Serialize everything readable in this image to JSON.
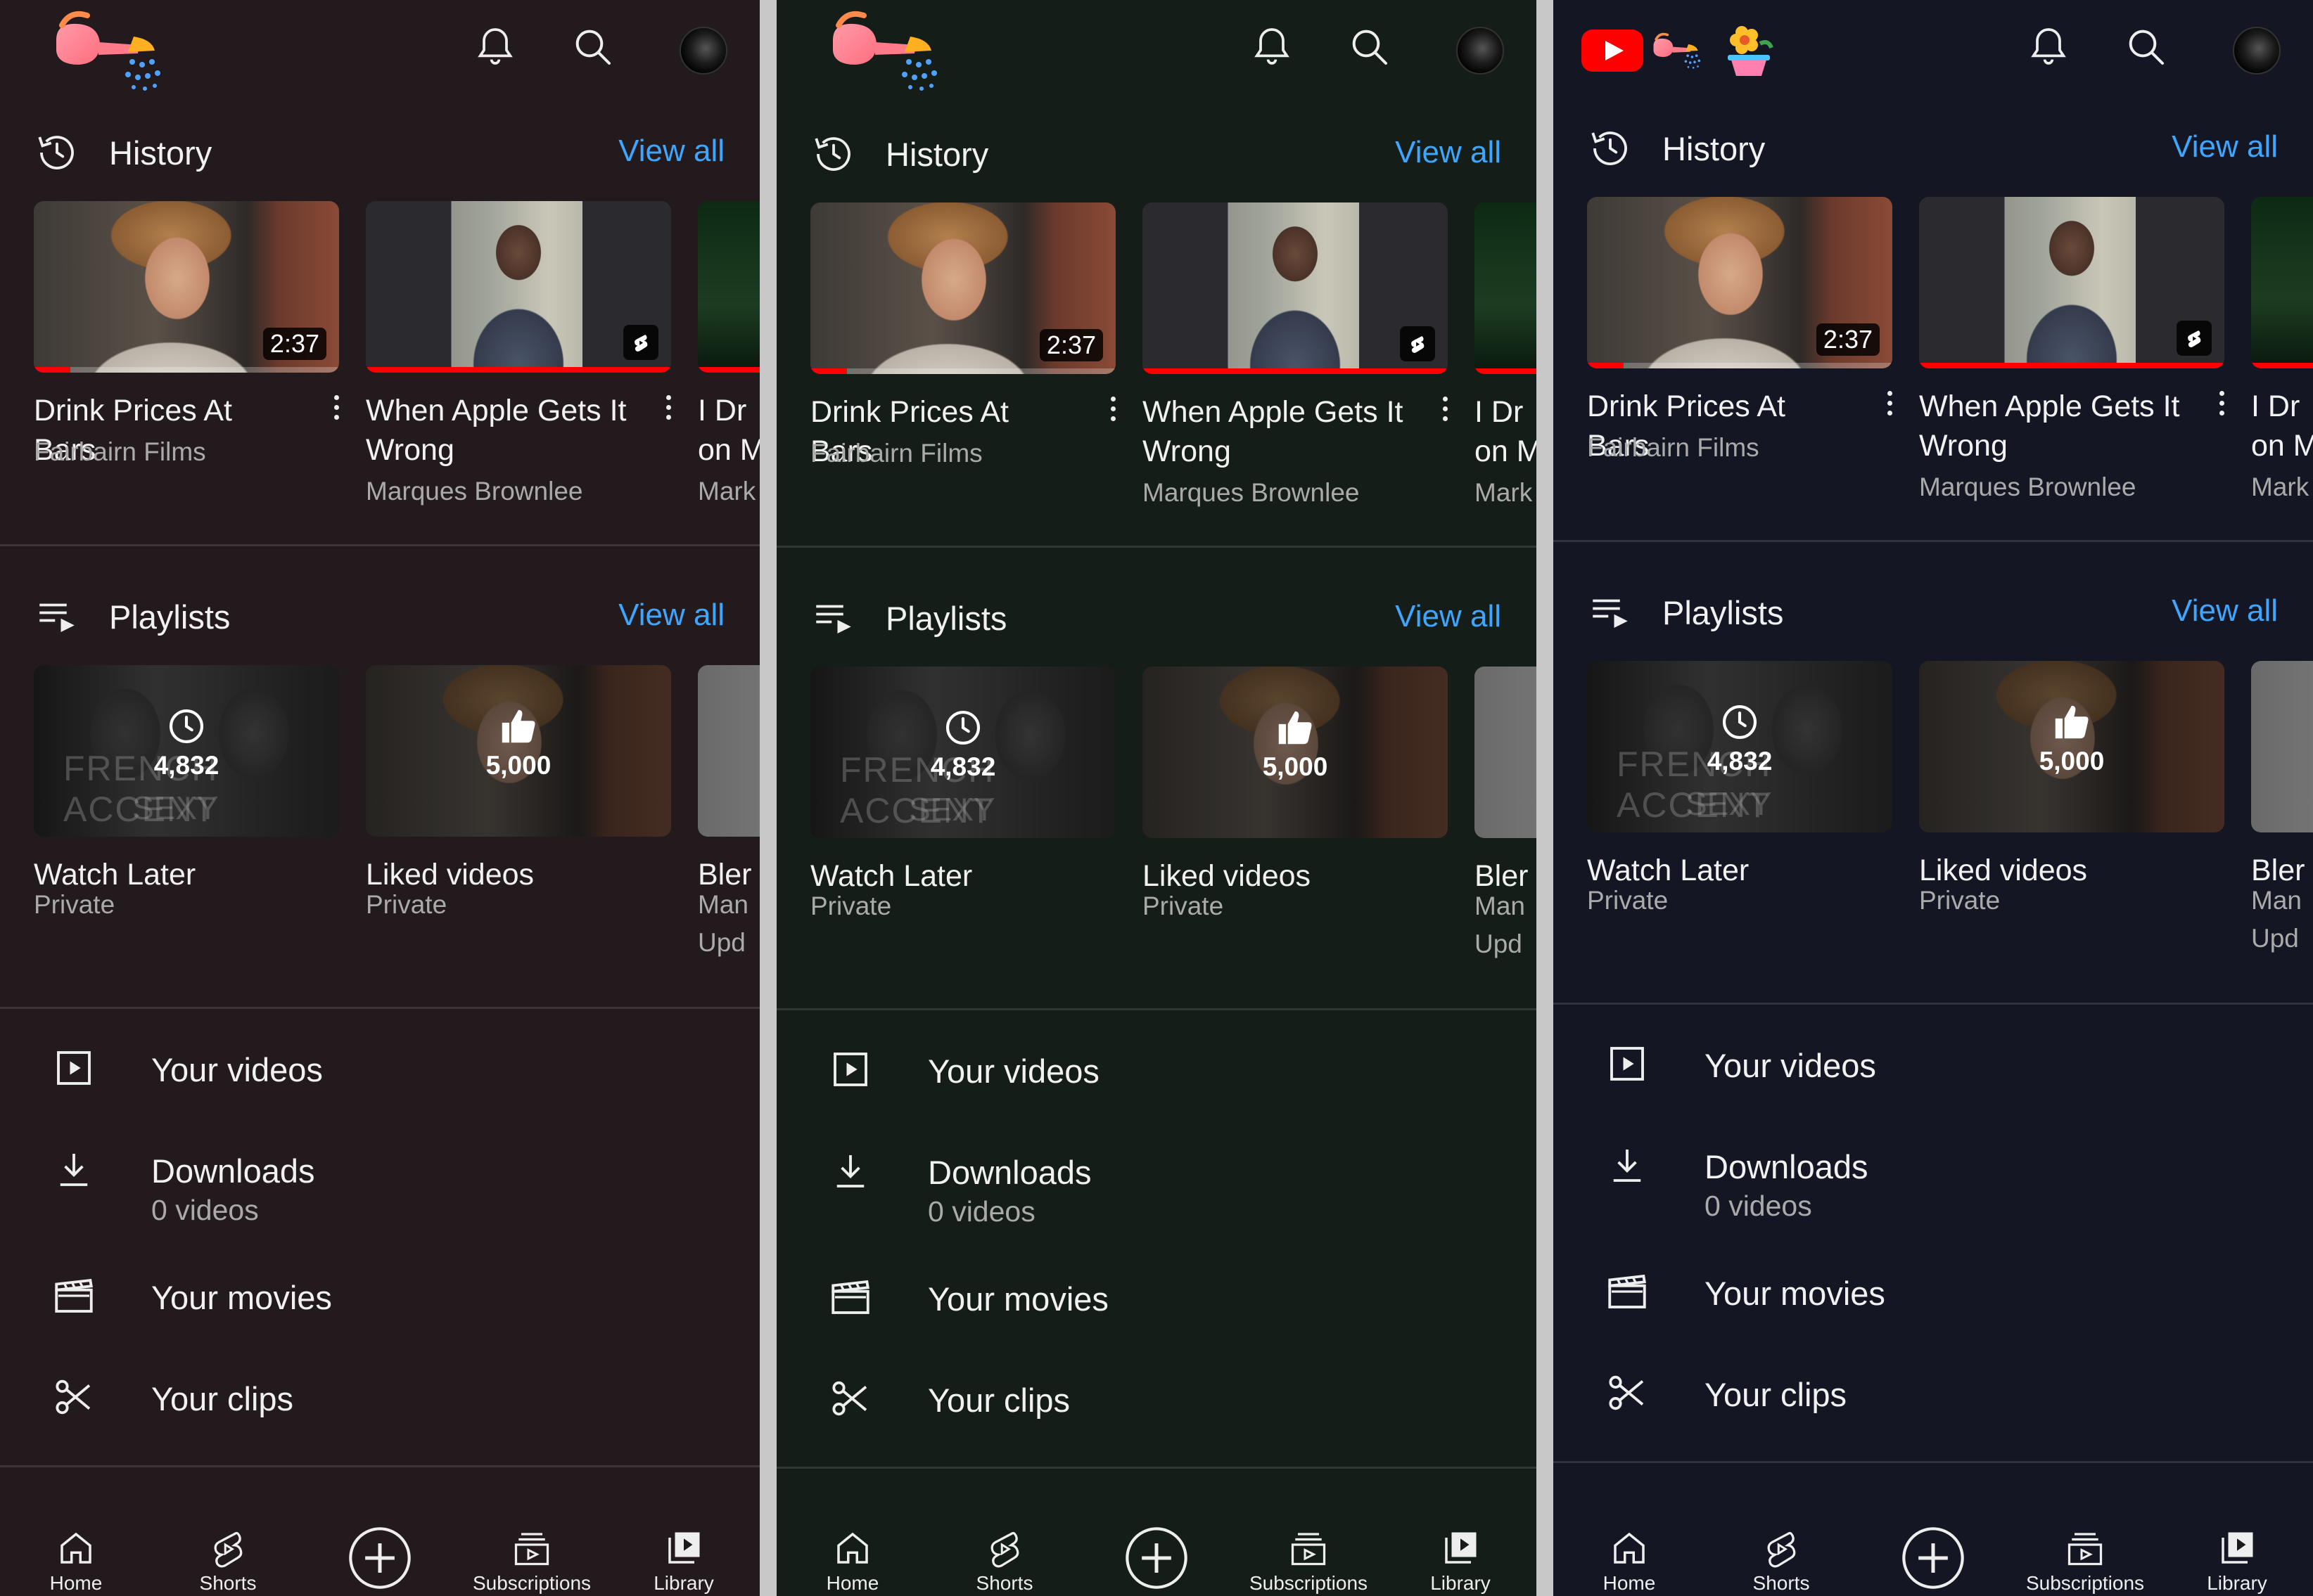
{
  "panels": [
    {
      "theme": "purple-dark",
      "bg": "#231a1e",
      "show_yt_logo": false
    },
    {
      "theme": "green-dark",
      "bg": "#141d17",
      "show_yt_logo": false
    },
    {
      "theme": "blue-dark",
      "bg": "#141723",
      "show_yt_logo": true
    }
  ],
  "header": {
    "logo_icons": [
      "watering-can-icon",
      "youtube-logo-icon",
      "flower-pot-icon"
    ],
    "notifications_icon": "bell-icon",
    "search_icon": "search-icon"
  },
  "history": {
    "title": "History",
    "view_all": "View all",
    "videos": [
      {
        "title": "Drink Prices At Bars",
        "channel": "Fairbairn Films",
        "duration": "2:37",
        "progress": 0.12,
        "type": "video"
      },
      {
        "title": "When Apple Gets It Wrong",
        "channel": "Marques Brownlee",
        "duration": "",
        "progress": 1.0,
        "type": "short"
      },
      {
        "title": "I Dr",
        "title_line2": "on M",
        "channel": "Mark",
        "duration": "",
        "progress": 1.0,
        "type": "video"
      }
    ]
  },
  "playlists": {
    "title": "Playlists",
    "view_all": "View all",
    "items": [
      {
        "title": "Watch Later",
        "privacy": "Private",
        "count": "4,832",
        "icon": "clock-icon",
        "watermark_line1": "FRENCH ACCENT",
        "watermark_small": "WHEN THE",
        "watermark_line2": "SEXY",
        "watermark_small2": "ISN'T"
      },
      {
        "title": "Liked videos",
        "privacy": "Private",
        "count": "5,000",
        "icon": "thumbs-up-icon"
      },
      {
        "title": "Bler",
        "privacy": "Man",
        "extra": "Upd"
      }
    ]
  },
  "menu": [
    {
      "label": "Your videos",
      "icon": "play-square-icon",
      "sub": ""
    },
    {
      "label": "Downloads",
      "icon": "download-icon",
      "sub": "0 videos"
    },
    {
      "label": "Your movies",
      "icon": "clapperboard-icon",
      "sub": ""
    },
    {
      "label": "Your clips",
      "icon": "scissors-icon",
      "sub": ""
    }
  ],
  "nav": [
    {
      "label": "Home",
      "icon": "home-icon"
    },
    {
      "label": "Shorts",
      "icon": "shorts-icon"
    },
    {
      "label": "",
      "icon": "create-plus-icon"
    },
    {
      "label": "Subscriptions",
      "icon": "subscriptions-icon"
    },
    {
      "label": "Library",
      "icon": "library-icon"
    }
  ],
  "colors": {
    "accent_link": "#3ea6ff",
    "progress_red": "#ff0000",
    "yt_red": "#ff0000"
  }
}
